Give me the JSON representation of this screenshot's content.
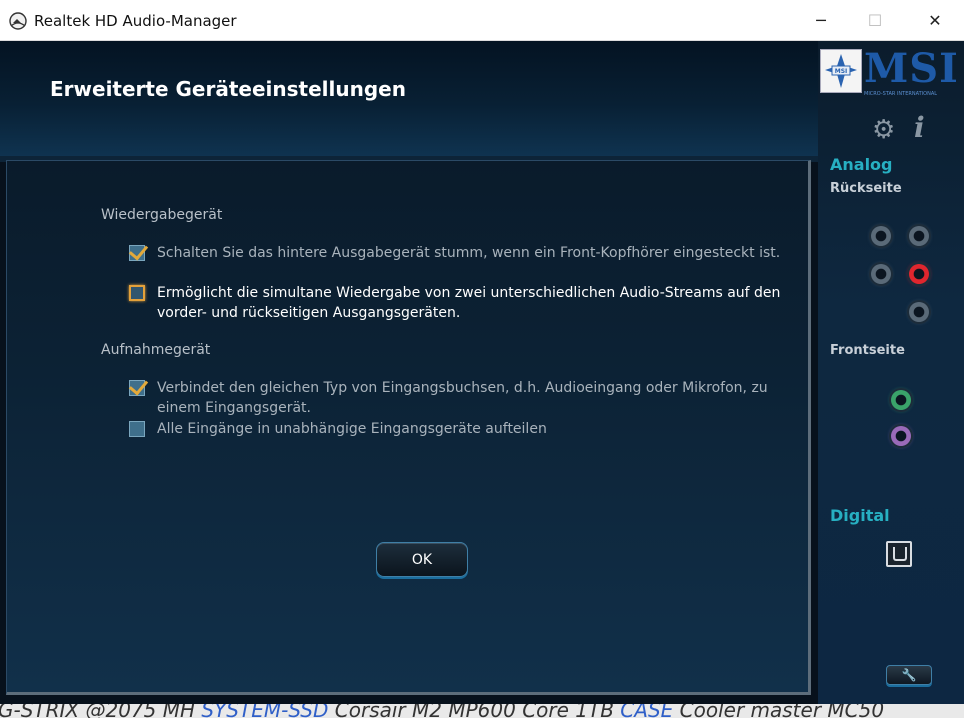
{
  "window": {
    "title": "Realtek HD Audio-Manager",
    "min_glyph": "─",
    "max_glyph": "☐",
    "close_glyph": "✕"
  },
  "header": {
    "title": "Erweiterte Geräteeinstellungen"
  },
  "playback": {
    "section_label": "Wiedergabegerät",
    "options": [
      {
        "label": "Schalten Sie das hintere Ausgabegerät stumm, wenn ein Front-Kopfhörer eingesteckt ist.",
        "checked": true
      },
      {
        "label": "Ermöglicht die simultane Wiedergabe von zwei unterschiedlichen Audio-Streams auf den vorder- und rückseitigen Ausgangsgeräten.",
        "checked": false,
        "focused": true
      }
    ]
  },
  "recording": {
    "section_label": "Aufnahmegerät",
    "options": [
      {
        "label": "Verbindet den gleichen Typ von Eingangsbuchsen, d.h. Audioeingang oder Mikrofon, zu einem Eingangsgerät.",
        "checked": true
      },
      {
        "label": "Alle Eingänge in unabhängige Eingangsgeräte aufteilen",
        "checked": false
      }
    ]
  },
  "ok_button": {
    "label": "OK"
  },
  "sidebar": {
    "logo_text": "MSI",
    "logo_subtext": "MICRO-STAR INTERNATIONAL",
    "analog_label": "Analog",
    "rear_label": "Rückseite",
    "front_label": "Frontseite",
    "digital_label": "Digital",
    "rear_jacks": [
      "#5a6a78",
      "#5a6a78",
      "#5a6a78",
      "#e0262e",
      "#5a6a78"
    ],
    "front_jacks": [
      "#3aa36a",
      "#9a6ab8"
    ]
  },
  "background_strip": {
    "part1": "G-STRIX @2075 MH",
    "link1": "SYSTEM-SSD",
    "part2": "Corsair M2 MP600 Core 1TB",
    "link2": "CASE",
    "part3": "Cooler master MC50"
  }
}
